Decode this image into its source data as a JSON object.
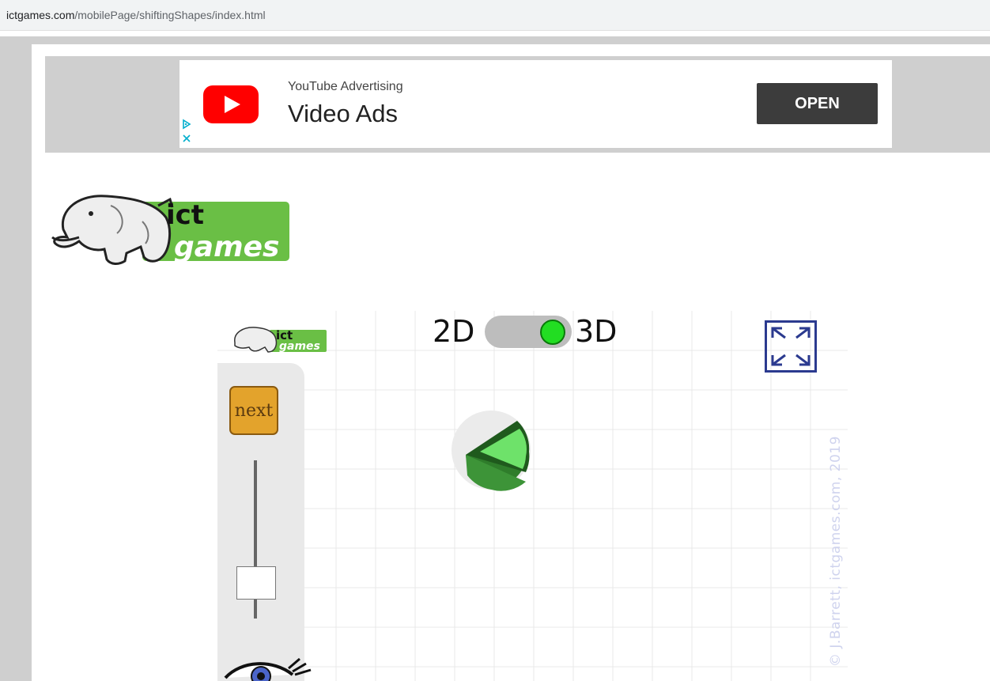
{
  "browser": {
    "url_host": "ictgames.com",
    "url_path": "/mobilePage/shiftingShapes/index.html"
  },
  "ad": {
    "brand": "YouTube Advertising",
    "title": "Video Ads",
    "open_label": "OPEN",
    "icons": [
      "youtube-logo-icon",
      "adchoices-icon",
      "close-icon"
    ],
    "colors": {
      "youtube_red": "#ff0000",
      "button_bg": "#3c3c3c"
    }
  },
  "logo": {
    "line1": "ict",
    "line2": "games"
  },
  "game": {
    "mode_2d_label": "2D",
    "mode_3d_label": "3D",
    "mode_selected": "3D",
    "next_label": "next",
    "copyright": "© J.Barrett, ictgames.com, 2019",
    "icons": [
      "fullscreen-icon",
      "eye-icon",
      "elephant-logo-icon"
    ],
    "colors": {
      "toggle_on": "#22dd22",
      "next_button": "#e3a32c",
      "shape_light": "#6ee26a",
      "shape_dark": "#2f7d2b"
    }
  }
}
